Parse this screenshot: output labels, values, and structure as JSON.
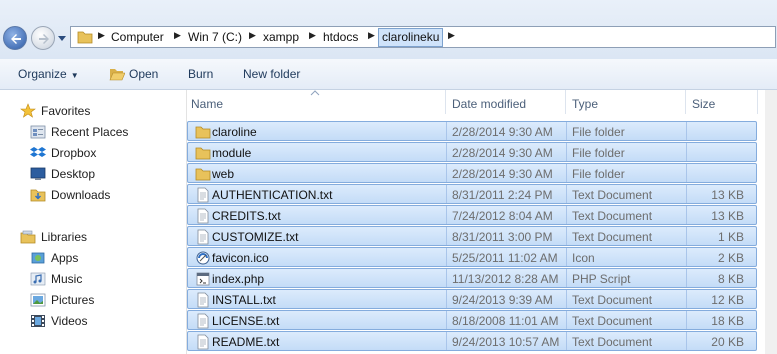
{
  "address": {
    "breadcrumbs": [
      "Computer",
      "Win 7 (C:)",
      "xampp",
      "htdocs",
      "clarolineku"
    ]
  },
  "toolbar": {
    "organize": "Organize",
    "open": "Open",
    "burn": "Burn",
    "new_folder": "New folder"
  },
  "nav": {
    "favorites": "Favorites",
    "recent_places": "Recent Places",
    "dropbox": "Dropbox",
    "desktop": "Desktop",
    "downloads": "Downloads",
    "libraries": "Libraries",
    "apps": "Apps",
    "music": "Music",
    "pictures": "Pictures",
    "videos": "Videos"
  },
  "columns": {
    "name": "Name",
    "date": "Date modified",
    "type": "Type",
    "size": "Size"
  },
  "files": [
    {
      "name": "claroline",
      "date": "2/28/2014 9:30 AM",
      "type": "File folder",
      "size": "",
      "icon": "folder-icon"
    },
    {
      "name": "module",
      "date": "2/28/2014 9:30 AM",
      "type": "File folder",
      "size": "",
      "icon": "folder-icon"
    },
    {
      "name": "web",
      "date": "2/28/2014 9:30 AM",
      "type": "File folder",
      "size": "",
      "icon": "folder-icon"
    },
    {
      "name": "AUTHENTICATION.txt",
      "date": "8/31/2011 2:24 PM",
      "type": "Text Document",
      "size": "13 KB",
      "icon": "text-file-icon"
    },
    {
      "name": "CREDITS.txt",
      "date": "7/24/2012 8:04 AM",
      "type": "Text Document",
      "size": "13 KB",
      "icon": "text-file-icon"
    },
    {
      "name": "CUSTOMIZE.txt",
      "date": "8/31/2011 3:00 PM",
      "type": "Text Document",
      "size": "1 KB",
      "icon": "text-file-icon"
    },
    {
      "name": "favicon.ico",
      "date": "5/25/2011 11:02 AM",
      "type": "Icon",
      "size": "2 KB",
      "icon": "ico-file-icon"
    },
    {
      "name": "index.php",
      "date": "11/13/2012 8:28 AM",
      "type": "PHP Script",
      "size": "8 KB",
      "icon": "php-file-icon"
    },
    {
      "name": "INSTALL.txt",
      "date": "9/24/2013 9:39 AM",
      "type": "Text Document",
      "size": "12 KB",
      "icon": "text-file-icon"
    },
    {
      "name": "LICENSE.txt",
      "date": "8/18/2008 11:01 AM",
      "type": "Text Document",
      "size": "18 KB",
      "icon": "text-file-icon"
    },
    {
      "name": "README.txt",
      "date": "9/24/2013 10:57 AM",
      "type": "Text Document",
      "size": "20 KB",
      "icon": "text-file-icon"
    }
  ]
}
